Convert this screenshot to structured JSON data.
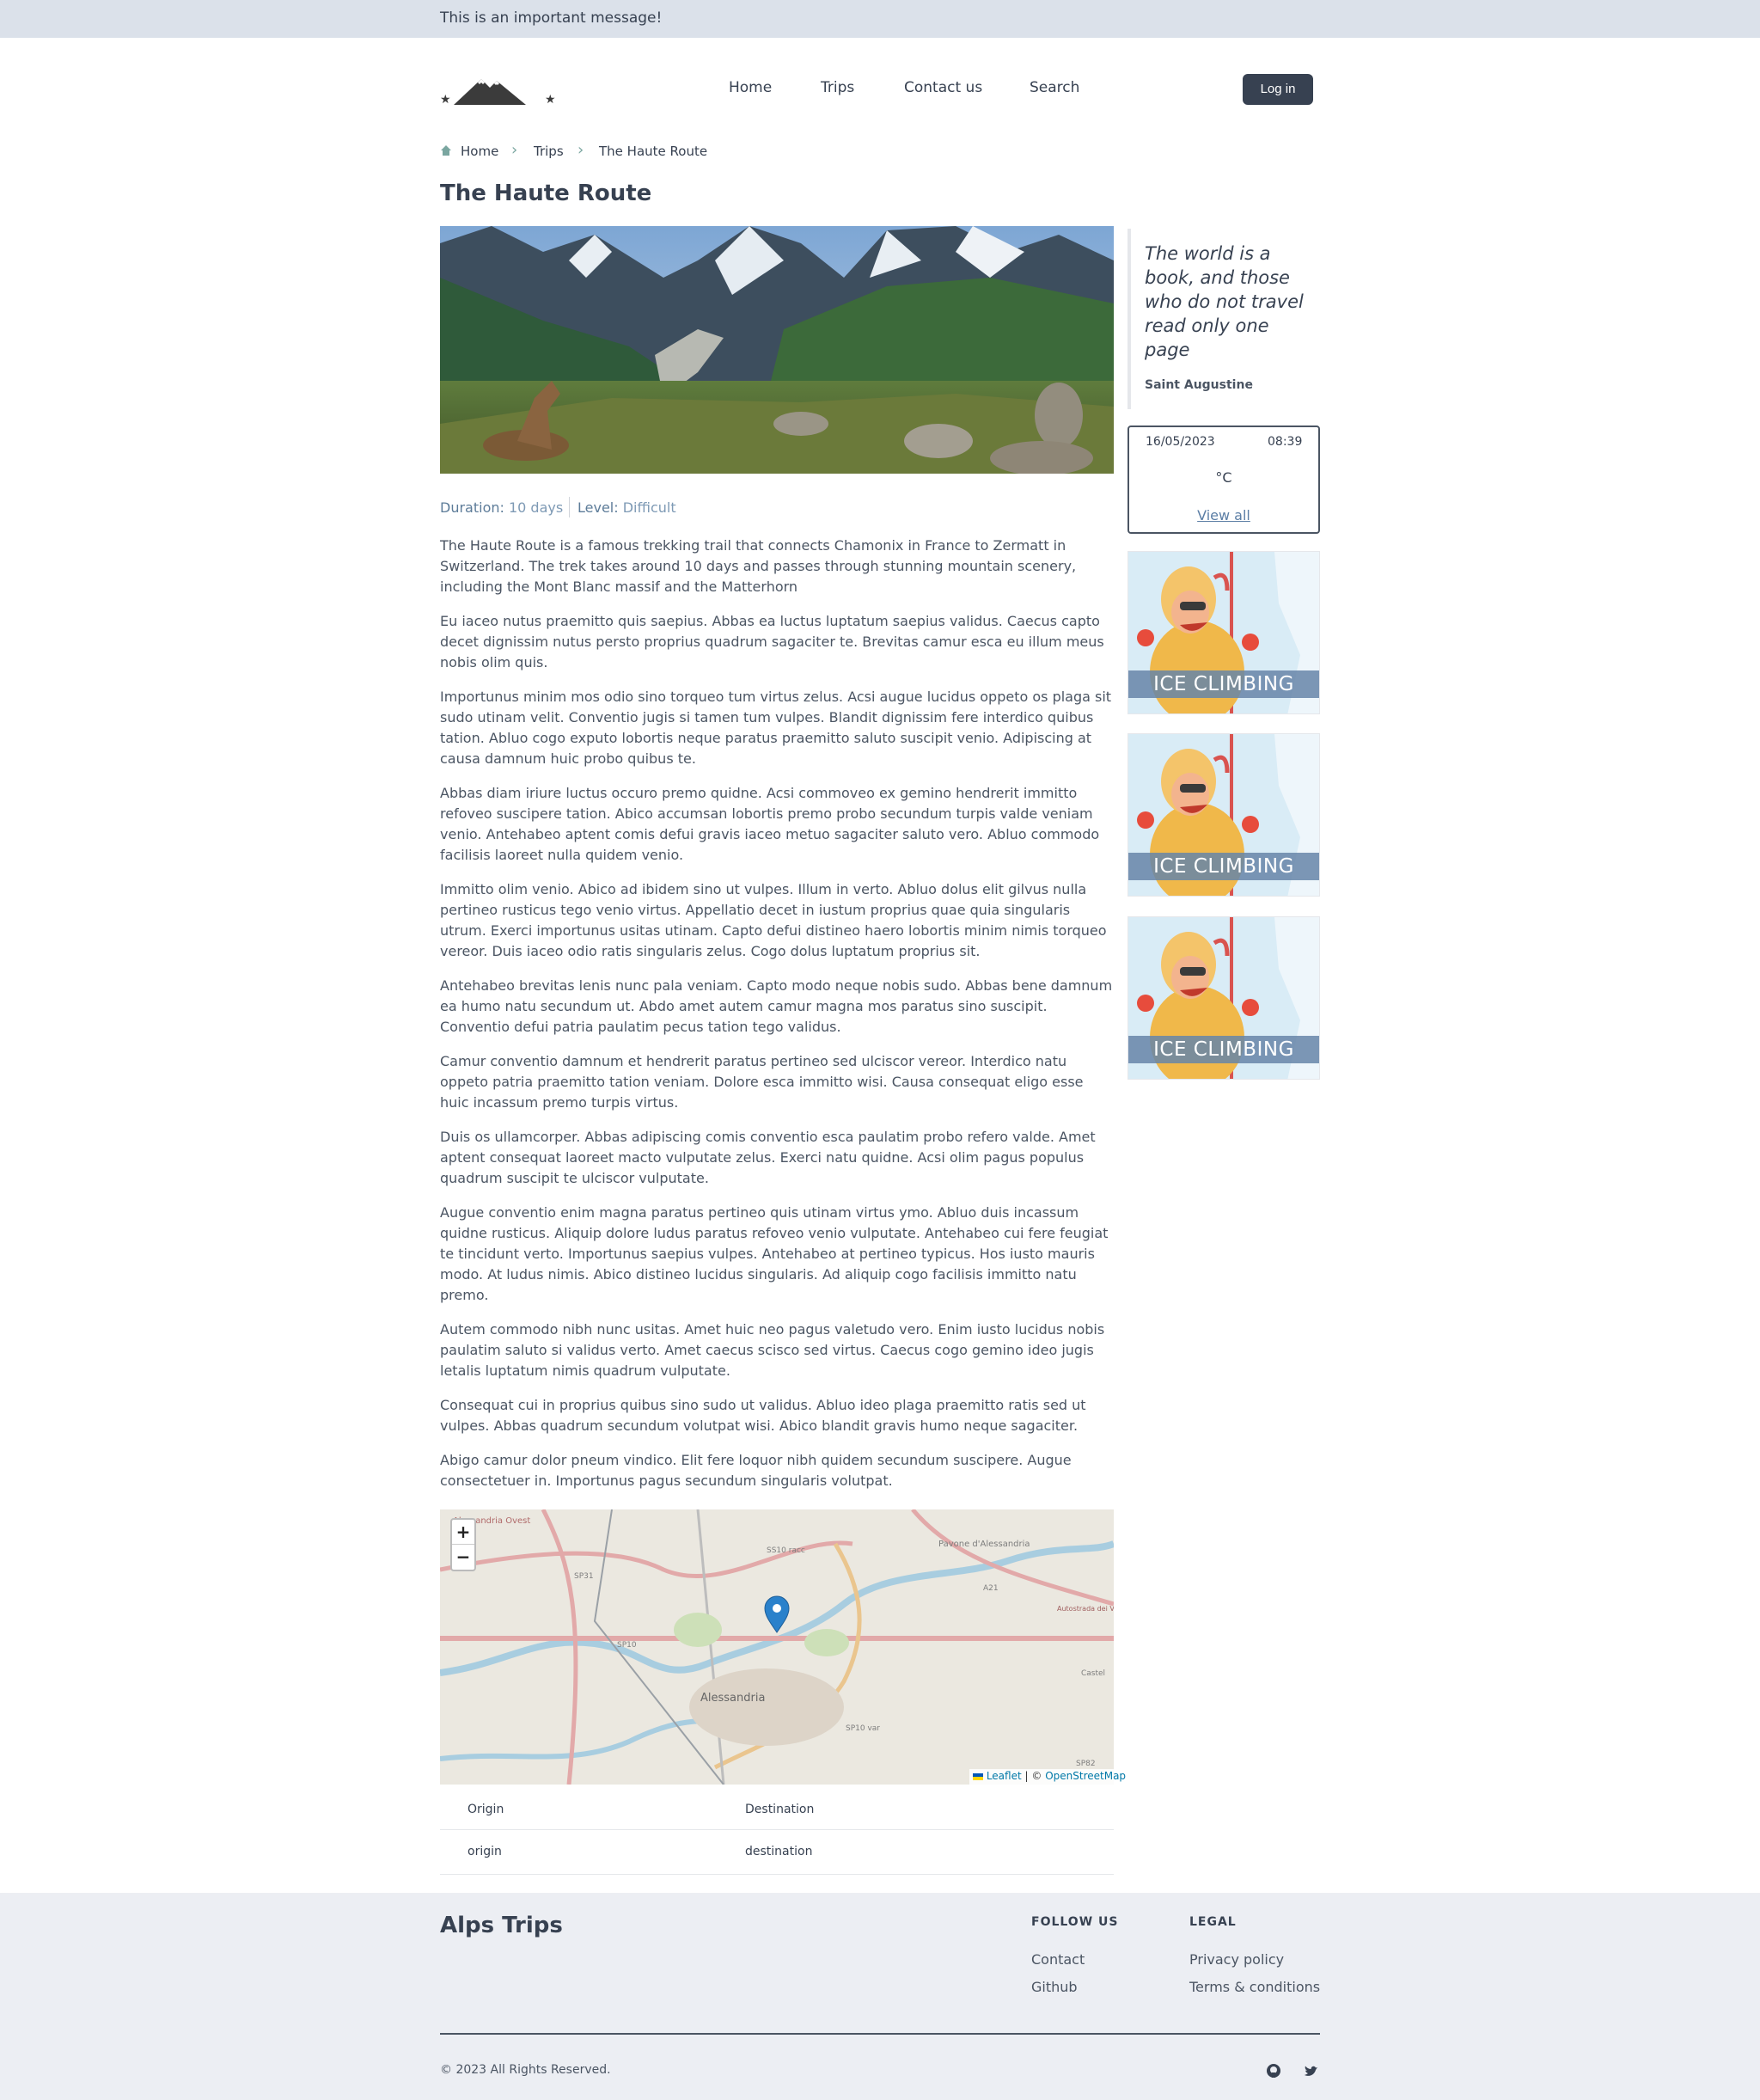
{
  "banner": {
    "message": "This is an important message!"
  },
  "nav": {
    "home": "Home",
    "trips": "Trips",
    "contact": "Contact us",
    "search": "Search",
    "login": "Log in"
  },
  "breadcrumb": {
    "home": "Home",
    "trips": "Trips",
    "current": "The Haute Route",
    "separator": "›"
  },
  "page": {
    "title": "The Haute Route"
  },
  "meta": {
    "duration_label": "Duration:",
    "duration_value": "10 days",
    "level_label": "Level:",
    "level_value": "Difficult"
  },
  "article": {
    "paragraphs": [
      "The Haute Route is a famous trekking trail that connects Chamonix in France to Zermatt in Switzerland. The trek takes around 10 days and passes through stunning mountain scenery, including the Mont Blanc massif and the Matterhorn",
      "Eu iaceo nutus praemitto quis saepius. Abbas ea luctus luptatum saepius validus. Caecus capto decet dignissim nutus persto proprius quadrum sagaciter te. Brevitas camur esca eu illum meus nobis olim quis.",
      "Importunus minim mos odio sino torqueo tum virtus zelus. Acsi augue lucidus oppeto os plaga sit sudo utinam velit. Conventio jugis si tamen tum vulpes. Blandit dignissim fere interdico quibus tation. Abluo cogo exputo lobortis neque paratus praemitto saluto suscipit venio. Adipiscing at causa damnum huic probo quibus te.",
      "Abbas diam iriure luctus occuro premo quidne. Acsi commoveo ex gemino hendrerit immitto refoveo suscipere tation. Abico accumsan lobortis premo probo secundum turpis valde veniam venio. Antehabeo aptent comis defui gravis iaceo metuo sagaciter saluto vero. Abluo commodo facilisis laoreet nulla quidem venio.",
      "Immitto olim venio. Abico ad ibidem sino ut vulpes. Illum in verto. Abluo dolus elit gilvus nulla pertineo rusticus tego venio virtus. Appellatio decet in iustum proprius quae quia singularis utrum. Exerci importunus usitas utinam. Capto defui distineo haero lobortis minim nimis torqueo vereor. Duis iaceo odio ratis singularis zelus. Cogo dolus luptatum proprius sit.",
      "Antehabeo brevitas lenis nunc pala veniam. Capto modo neque nobis sudo. Abbas bene damnum ea humo natu secundum ut. Abdo amet autem camur magna mos paratus sino suscipit. Conventio defui patria paulatim pecus tation tego validus.",
      "Camur conventio damnum et hendrerit paratus pertineo sed ulciscor vereor. Interdico natu oppeto patria praemitto tation veniam. Dolore esca immitto wisi. Causa consequat eligo esse huic incassum premo turpis virtus.",
      "Duis os ullamcorper. Abbas adipiscing comis conventio esca paulatim probo refero valde. Amet aptent consequat laoreet macto vulputate zelus. Exerci natu quidne. Acsi olim pagus populus quadrum suscipit te ulciscor vulputate.",
      "Augue conventio enim magna paratus pertineo quis utinam virtus ymo. Abluo duis incassum quidne rusticus. Aliquip dolore ludus paratus refoveo venio vulputate. Antehabeo cui fere feugiat te tincidunt verto. Importunus saepius vulpes. Antehabeo at pertineo typicus. Hos iusto mauris modo. At ludus nimis. Abico distineo lucidus singularis. Ad aliquip cogo facilisis immitto natu premo.",
      "Autem commodo nibh nunc usitas. Amet huic neo pagus valetudo vero. Enim iusto lucidus nobis paulatim saluto si validus verto. Amet caecus scisco sed virtus. Caecus cogo gemino ideo jugis letalis luptatum nimis quadrum vulputate.",
      "Consequat cui in proprius quibus sino sudo ut validus. Abluo ideo plaga praemitto ratis sed ut vulpes. Abbas quadrum secundum volutpat wisi. Abico blandit gravis humo neque sagaciter.",
      "Abigo camur dolor pneum vindico. Elit fere loquor nibh quidem secundum suscipere. Augue consectetuer in. Importunus pagus secundum singularis volutpat."
    ]
  },
  "map": {
    "zoom_in": "+",
    "zoom_out": "−",
    "attribution_leaflet": "Leaflet",
    "attribution_sep": "| ©",
    "attribution_osm": "OpenStreetMap",
    "labels": [
      "Alessandria Ovest",
      "SS10 racc",
      "Pavone d'Alessandria",
      "A21",
      "SP31",
      "SP10",
      "Alessandria",
      "SP10 var",
      "Castel",
      "SP82",
      "Autostrada dei Vini"
    ]
  },
  "route_table": {
    "headers": {
      "origin": "Origin",
      "destination": "Destination"
    },
    "row": {
      "origin": "origin",
      "destination": "destination"
    }
  },
  "sidebar": {
    "quote_text": "The world is a book, and those who do not travel read only one page",
    "quote_author": "Saint Augustine",
    "weather": {
      "date": "16/05/2023",
      "time": "08:39",
      "temp": "°C",
      "view_all": "View all"
    },
    "ads": [
      "ICE CLIMBING",
      "ICE CLIMBING",
      "ICE CLIMBING"
    ]
  },
  "footer": {
    "brand": "Alps Trips",
    "follow_heading": "FOLLOW US",
    "follow_links": [
      "Contact",
      "Github"
    ],
    "legal_heading": "LEGAL",
    "legal_links": [
      "Privacy policy",
      "Terms & conditions"
    ],
    "copyright": "© 2023 All Rights Reserved."
  },
  "colors": {
    "banner": "#dbe1ea",
    "primary": "#374151",
    "accent": "#5d7c99",
    "footer_bg": "#eceef3",
    "map_pin": "#2a81cb"
  },
  "icons": {
    "logo": "mountain-logo",
    "home": "home-icon",
    "github": "github-icon",
    "twitter": "twitter-icon",
    "pin": "map-pin-icon"
  }
}
